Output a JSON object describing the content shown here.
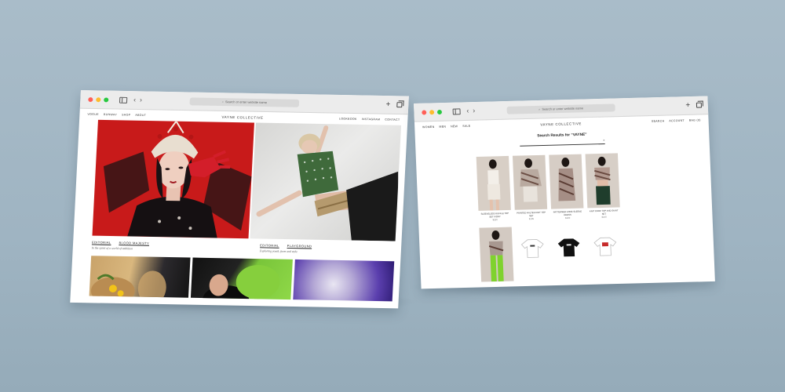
{
  "colors": {
    "background": "#a9bcc9",
    "window_red": "#ff5f57",
    "window_yellow": "#febc2e",
    "window_green": "#28c840",
    "editorial_red": "#c81a1a"
  },
  "left_browser": {
    "address_placeholder": "Search or enter website name",
    "nav_left": [
      "VOGUE",
      "RUNWAY",
      "SHOP",
      "ABOUT"
    ],
    "logo": "VAYNE COLLECTIVE",
    "nav_right": [
      "LOOKBOOK",
      "INSTAGRAM",
      "CONTACT"
    ],
    "stories": [
      {
        "tags": [
          "EDITORIAL",
          "BLOOD MAJESTY"
        ],
        "subtitle": "In the spirit of a world of ambition"
      },
      {
        "tags": [
          "EDITORIAL",
          "PLAYGROUND"
        ],
        "subtitle": "Exploring youth, form and style"
      }
    ]
  },
  "right_browser": {
    "address_placeholder": "Search or enter website name",
    "nav_left": [
      "WOMEN",
      "MEN",
      "NEW",
      "SALE"
    ],
    "logo": "VAYNE COLLECTIVE",
    "nav_right": [
      "SEARCH",
      "ACCOUNT",
      "BAG (0)"
    ],
    "search_title": "Search Results for “VAYNE”",
    "search_clear": "×",
    "products": [
      {
        "name": "SLEEVELESS RUFFLE TOP SET IVORY",
        "price": "$180"
      },
      {
        "name": "PRINTED HALTER KNIT TOP SET",
        "price": "$195"
      },
      {
        "name": "PATTERNED LONG SLEEVE DRESS",
        "price": "$220"
      },
      {
        "name": "KNIT CROP TOP AND SKIRT SET",
        "price": "$240"
      },
      {
        "name": "",
        "price": ""
      },
      {
        "name": "",
        "price": ""
      },
      {
        "name": "",
        "price": ""
      },
      {
        "name": "",
        "price": ""
      }
    ]
  }
}
